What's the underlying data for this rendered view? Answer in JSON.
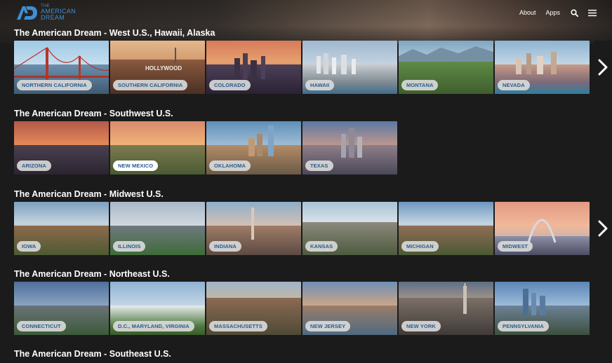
{
  "header": {
    "logo_small": "THE",
    "logo_line1": "AMERICAN",
    "logo_line2": "DREAM",
    "nav": {
      "about": "About",
      "apps": "Apps"
    },
    "icons": {
      "search": "search-icon",
      "menu": "hamburger-menu-icon"
    }
  },
  "sections": [
    {
      "title": "The American Dream - West U.S., Hawaii, Alaska",
      "tiles": [
        "NORTHERN CALIFORNIA",
        "SOUTHERN CALIFORNIA",
        "COLORADO",
        "HAWAII",
        "MONTANA",
        "NEVADA"
      ],
      "has_next": true
    },
    {
      "title": "The American Dream - Southwest U.S.",
      "tiles": [
        "ARIZONA",
        "NEW MEXICO",
        "OKLAHOMA",
        "TEXAS"
      ],
      "has_next": false
    },
    {
      "title": "The American Dream - Midwest U.S.",
      "tiles": [
        "IOWA",
        "ILLINOIS",
        "INDIANA",
        "KANSAS",
        "MICHIGAN",
        "MIDWEST"
      ],
      "has_next": true
    },
    {
      "title": "The American Dream - Northeast U.S.",
      "tiles": [
        "CONNECTICUT",
        "D.C., MARYLAND, VIRGINIA",
        "MASSACHUSETTS",
        "NEW JERSEY",
        "NEW YORK",
        "PENNSYLVANIA"
      ],
      "has_next": false
    },
    {
      "title": "The American Dream - Southeast U.S.",
      "tiles": [],
      "has_next": false
    }
  ],
  "colors": {
    "label_text": "#2a5c8a",
    "logo_blue": "#3d8fd6",
    "background": "#1b1b1b"
  }
}
